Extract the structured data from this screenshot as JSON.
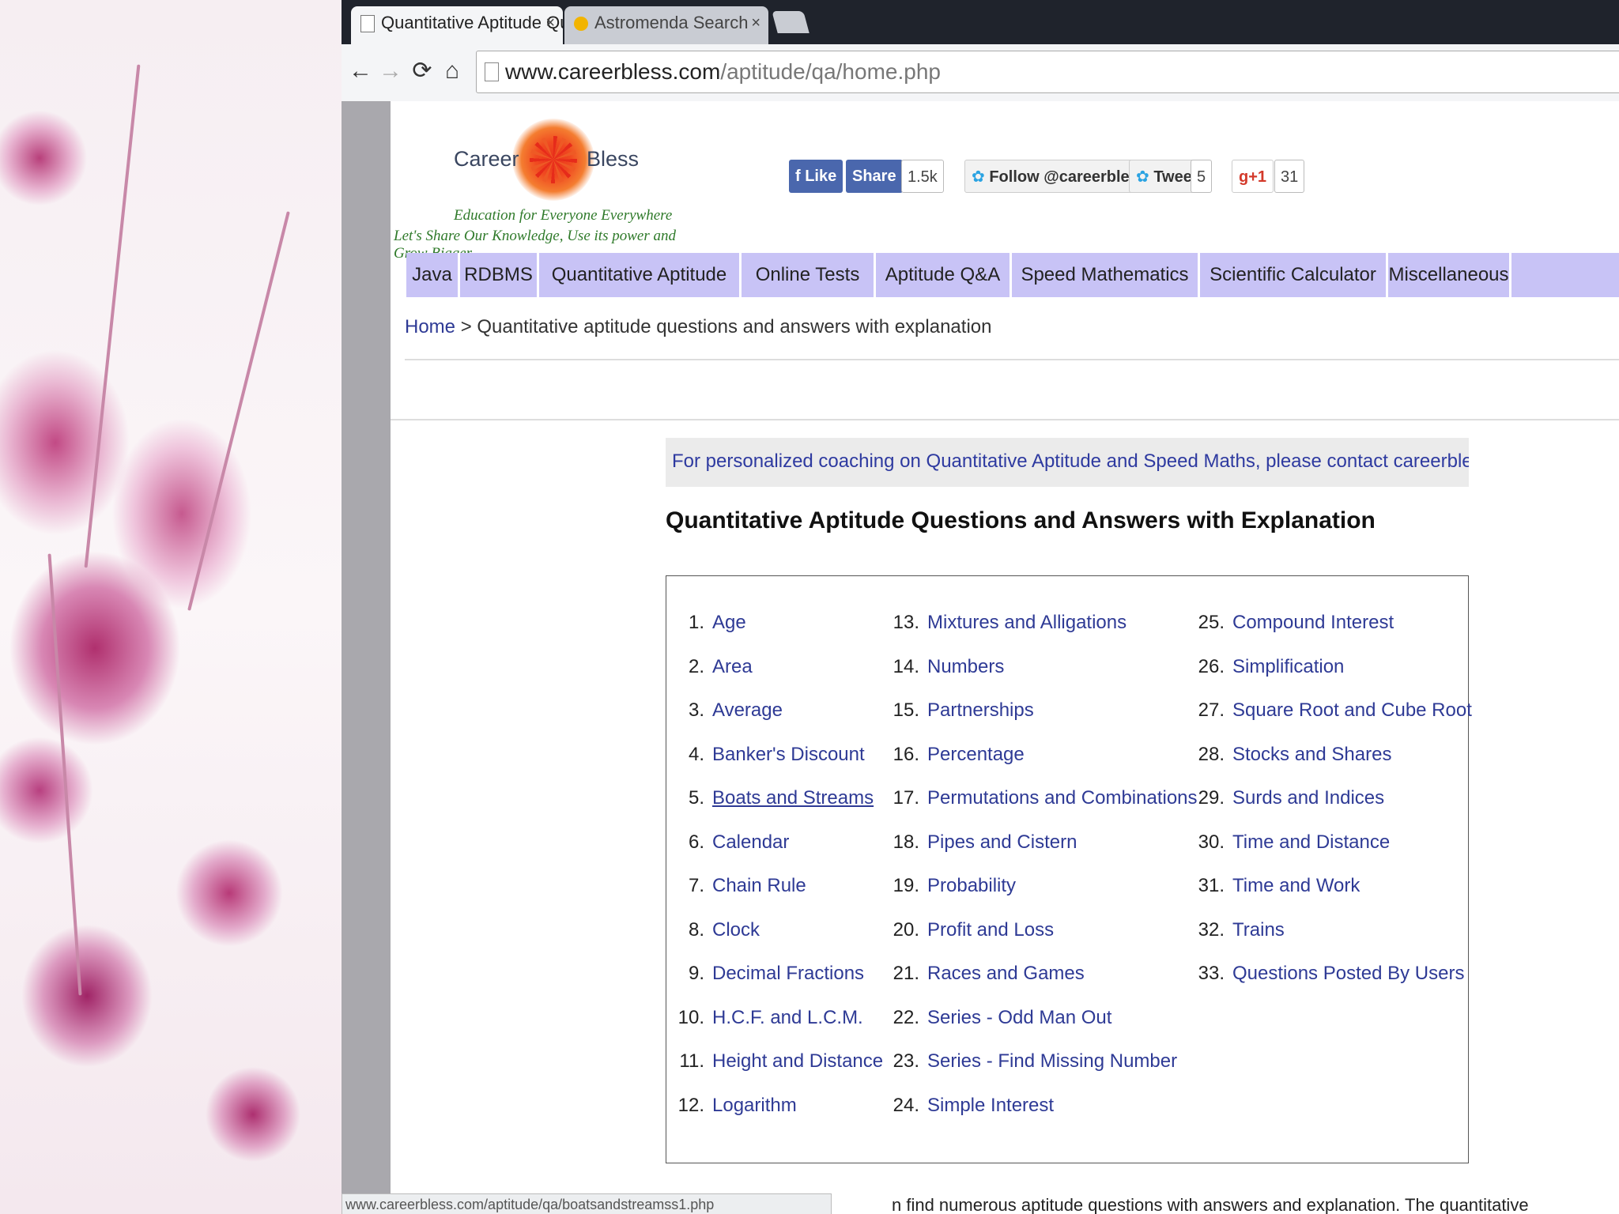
{
  "browser": {
    "tabs": [
      {
        "label": "Quantitative Aptitude Quѐ"
      },
      {
        "label": "Astromenda Search"
      }
    ],
    "tab_close": "×",
    "url_domain": "www.careerbless.com",
    "url_path": "/aptitude/qa/home.php",
    "status_url": "www.careerbless.com/aptitude/qa/boatsandstreamss1.php"
  },
  "header": {
    "logo_word1": "Career",
    "logo_word2": "Bless",
    "tagline1": "Education for Everyone Everywhere",
    "tagline2": "Let's Share Our Knowledge, Use its power and Grow Bigger",
    "social": {
      "like": "Like",
      "share": "Share",
      "share_count": "1.5k",
      "follow": "Follow @careerbless",
      "tweet": "Tweet",
      "tweet_count": "5",
      "gplus": "g+1",
      "gplus_count": "31"
    }
  },
  "nav": {
    "items": [
      "Java",
      "RDBMS",
      "Quantitative Aptitude",
      "Online Tests",
      "Aptitude Q&A",
      "Speed Mathematics",
      "Scientific Calculator",
      "Miscellaneous"
    ]
  },
  "breadcrumb": {
    "home": "Home",
    "sep": ">",
    "current": "Quantitative aptitude questions and answers with explanation"
  },
  "notice": "For personalized coaching on Quantitative Aptitude and Speed Maths, please contact careerbless@gmail.com",
  "title": "Quantitative Aptitude Questions and Answers with Explanation",
  "topics": {
    "col1": [
      {
        "n": "1.",
        "t": "Age"
      },
      {
        "n": "2.",
        "t": "Area"
      },
      {
        "n": "3.",
        "t": "Average"
      },
      {
        "n": "4.",
        "t": "Banker's Discount"
      },
      {
        "n": "5.",
        "t": "Boats and Streams"
      },
      {
        "n": "6.",
        "t": "Calendar"
      },
      {
        "n": "7.",
        "t": "Chain Rule"
      },
      {
        "n": "8.",
        "t": "Clock"
      },
      {
        "n": "9.",
        "t": "Decimal Fractions"
      },
      {
        "n": "10.",
        "t": "H.C.F. and L.C.M."
      },
      {
        "n": "11.",
        "t": "Height and Distance"
      },
      {
        "n": "12.",
        "t": "Logarithm"
      }
    ],
    "col2": [
      {
        "n": "13.",
        "t": "Mixtures and Alligations"
      },
      {
        "n": "14.",
        "t": "Numbers"
      },
      {
        "n": "15.",
        "t": "Partnerships"
      },
      {
        "n": "16.",
        "t": "Percentage"
      },
      {
        "n": "17.",
        "t": "Permutations and Combinations"
      },
      {
        "n": "18.",
        "t": "Pipes and Cistern"
      },
      {
        "n": "19.",
        "t": "Probability"
      },
      {
        "n": "20.",
        "t": "Profit and Loss"
      },
      {
        "n": "21.",
        "t": "Races and Games"
      },
      {
        "n": "22.",
        "t": "Series - Odd Man Out"
      },
      {
        "n": "23.",
        "t": "Series - Find Missing Number"
      },
      {
        "n": "24.",
        "t": "Simple Interest"
      }
    ],
    "col3": [
      {
        "n": "25.",
        "t": "Compound Interest"
      },
      {
        "n": "26.",
        "t": "Simplification"
      },
      {
        "n": "27.",
        "t": "Square Root and Cube Root"
      },
      {
        "n": "28.",
        "t": "Stocks and Shares"
      },
      {
        "n": "29.",
        "t": "Surds and Indices"
      },
      {
        "n": "30.",
        "t": "Time and Distance"
      },
      {
        "n": "31.",
        "t": "Time and Work"
      },
      {
        "n": "32.",
        "t": "Trains"
      },
      {
        "n": "33.",
        "t": "Questions Posted By Users"
      }
    ]
  },
  "footer_cut_text": "n find numerous aptitude questions with answers and explanation. The quantitative",
  "colors": {
    "nav_bg": "#c8c3f6",
    "link": "#2e3a95",
    "notice_text": "#2e3aa0",
    "facebook": "#4a67ad"
  }
}
